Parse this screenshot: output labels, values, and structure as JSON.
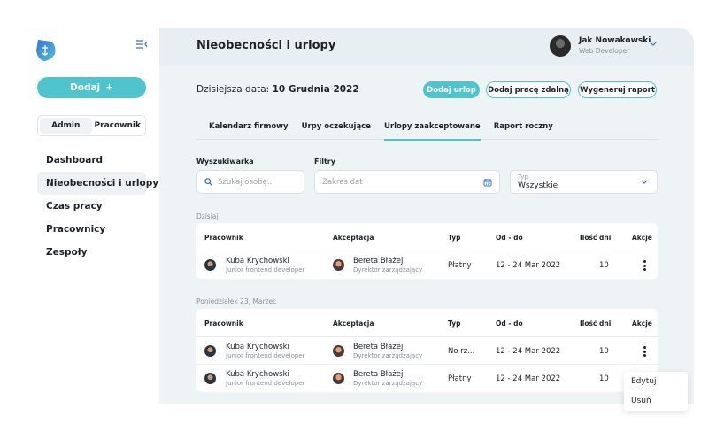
{
  "sidebar": {
    "add_label": "Dodaj",
    "add_icon": "+",
    "roles": [
      "Admin",
      "Pracownik"
    ],
    "nav": [
      "Dashboard",
      "Nieobecności i urlopy",
      "Czas pracy",
      "Pracownicy",
      "Zespoły"
    ]
  },
  "header": {
    "title": "Nieobecności i urlopy",
    "user_name": "Jak Nowakowski",
    "user_role": "Web Developer"
  },
  "toolbar": {
    "date_prefix": "Dzisiejsza data:",
    "date_value": "10 Grudnia 2022",
    "btn_add_leave": "Dodaj urlop",
    "btn_add_remote": "Dodaj pracę zdalną",
    "btn_report": "Wygeneruj raport"
  },
  "tabs": [
    "Kalendarz firmowy",
    "Urpy oczekujące",
    "Urlopy zaakceptowane",
    "Raport roczny"
  ],
  "filters": {
    "search_label": "Wyszukiwarka",
    "search_placeholder": "Szukaj osobę...",
    "filters_label": "Filtry",
    "date_placeholder": "Zakres dat",
    "type_caption": "Typ",
    "type_value": "Wszystkie"
  },
  "columns": [
    "Pracownik",
    "Akceptacja",
    "Typ",
    "Od - do",
    "Ilość dni",
    "Akcje"
  ],
  "groups": [
    {
      "label": "Dzisiaj",
      "rows": [
        {
          "name": "Kuba Krychowski",
          "title": "Junior frontend developer",
          "acc_name": "Bereta Błażej",
          "acc_title": "Dyrektor zarządzający",
          "type": "Płatny",
          "range": "12 - 24 Mar 2022",
          "days": "10"
        }
      ]
    },
    {
      "label": "Poniedziałek 23, Marzec",
      "rows": [
        {
          "name": "Kuba Krychowski",
          "title": "Junior frontend developer",
          "acc_name": "Bereta Błażej",
          "acc_title": "Dyrektor zarządzający",
          "type": "No rz...",
          "range": "12 - 24 Mar 2022",
          "days": "10"
        },
        {
          "name": "Kuba Krychowski",
          "title": "Junior frontend developer",
          "acc_name": "Bereta Błażej",
          "acc_title": "Dyrektor zarządzający",
          "type": "Płatny",
          "range": "12 - 24 Mar 2022",
          "days": "10"
        }
      ]
    }
  ],
  "context_menu": [
    "Edytuj",
    "Usuń"
  ],
  "colors": {
    "accent": "#4fc4cc",
    "main_bg": "#eef3f5",
    "brand": "#3b6fd8"
  }
}
